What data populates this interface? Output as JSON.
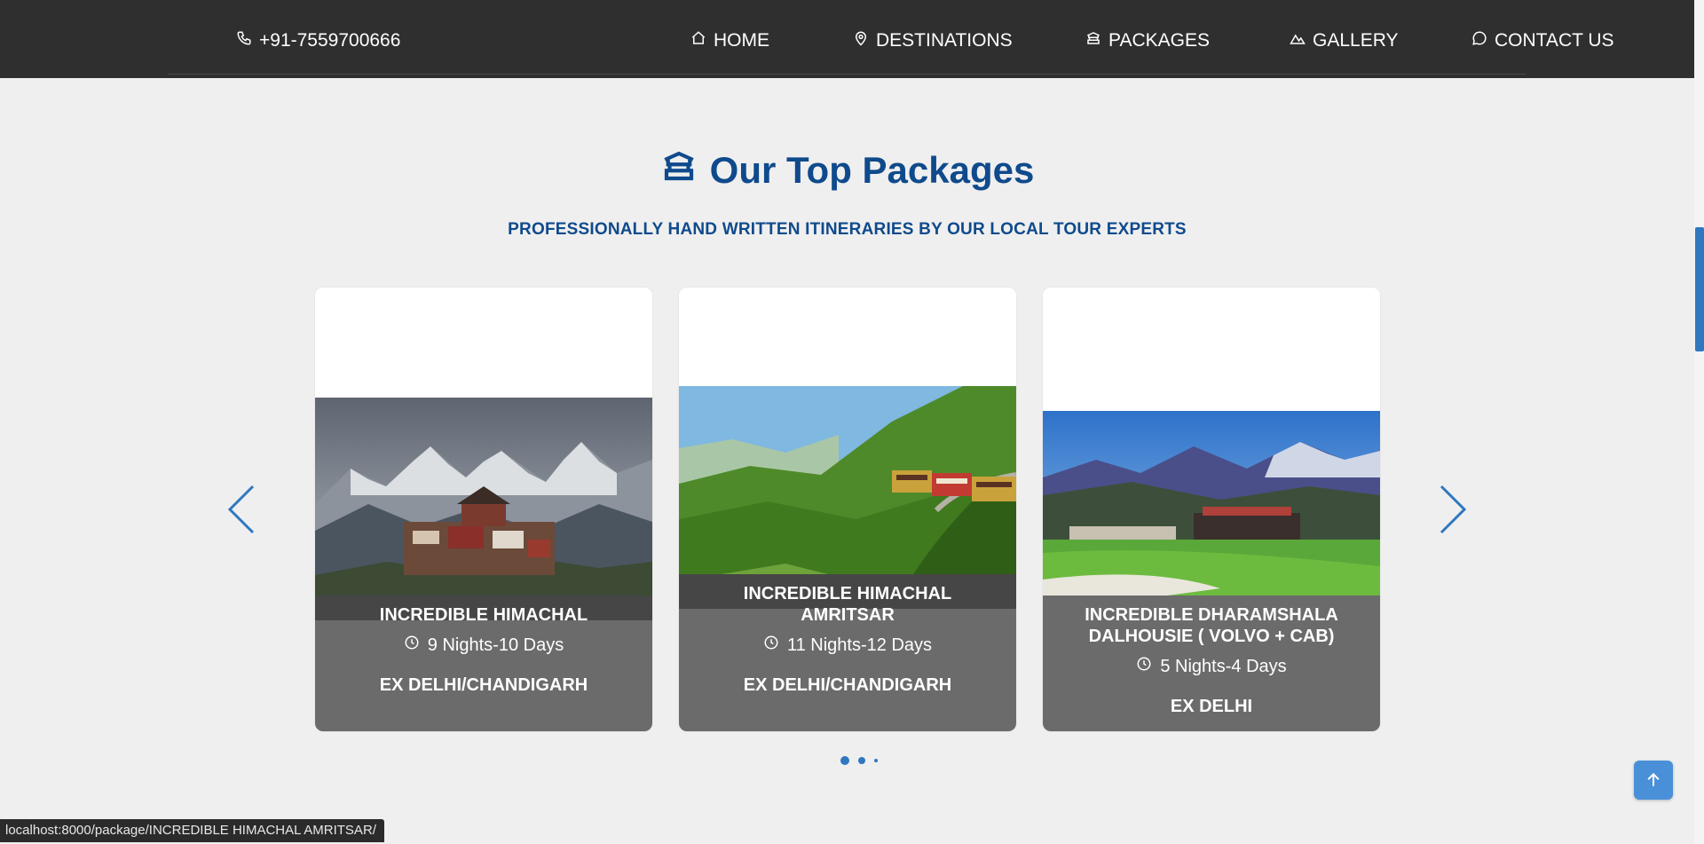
{
  "header": {
    "phone": "+91-7559700666",
    "nav": [
      {
        "label": "HOME",
        "icon": "home-icon"
      },
      {
        "label": "DESTINATIONS",
        "icon": "map-pin-icon"
      },
      {
        "label": "PACKAGES",
        "icon": "temple-icon"
      },
      {
        "label": "GALLERY",
        "icon": "mountain-icon"
      },
      {
        "label": "CONTACT US",
        "icon": "chat-bubble-icon"
      }
    ]
  },
  "section": {
    "title": "Our Top Packages",
    "title_icon": "temple-icon",
    "subtitle": "PROFESSIONALLY HAND WRITTEN ITINERARIES BY OUR LOCAL TOUR EXPERTS"
  },
  "packages": [
    {
      "name": "INCREDIBLE HIMACHAL",
      "duration": "9 Nights-10 Days",
      "from": "EX DELHI/CHANDIGARH",
      "image": "snowy mountain village"
    },
    {
      "name": "INCREDIBLE HIMACHAL AMRITSAR",
      "duration": "11 Nights-12 Days",
      "from": "EX DELHI/CHANDIGARH",
      "image": "toy train through green hills"
    },
    {
      "name": "INCREDIBLE DHARAMSHALA DALHOUSIE ( VOLVO + CAB)",
      "duration": "5 Nights-4 Days",
      "from": "EX DELHI",
      "image": "cricket stadium with mountains"
    }
  ],
  "carousel": {
    "prev": "chevron-left-icon",
    "next": "chevron-right-icon",
    "dots": 3,
    "active_dot": 0
  },
  "back_to_top": "arrow-up-icon",
  "status_bar": "localhost:8000/package/INCREDIBLE HIMACHAL AMRITSAR/",
  "colors": {
    "header_bg": "#2f2f2f",
    "accent": "#0f4a8c",
    "link_blue": "#2f77bf",
    "card_panel": "#6b6b6b"
  }
}
